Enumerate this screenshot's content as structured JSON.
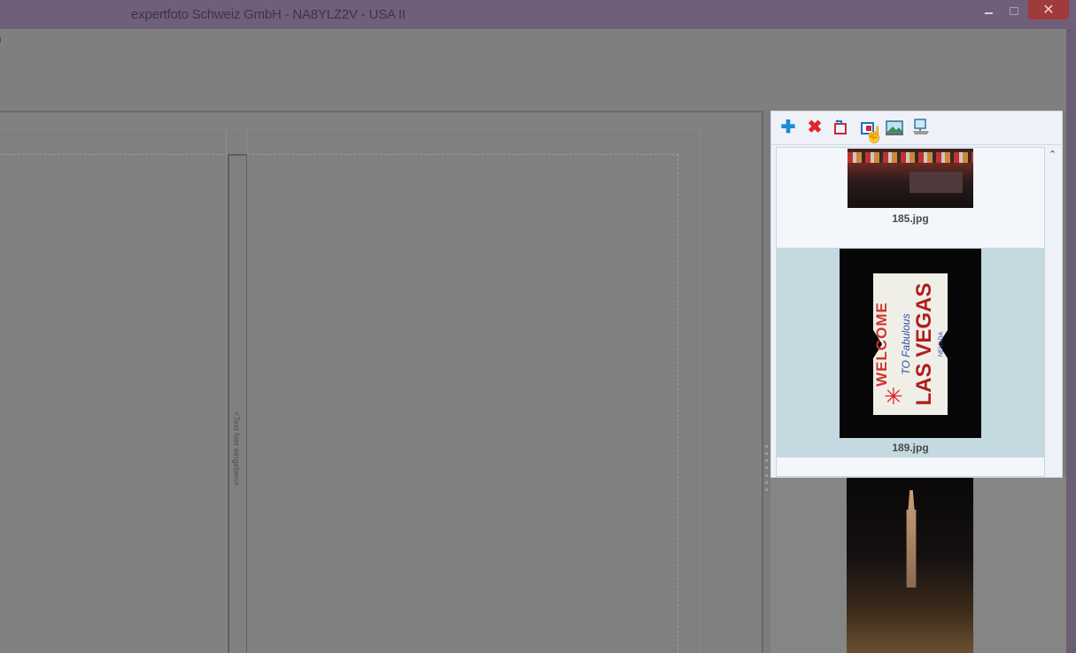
{
  "window": {
    "title": "expertfoto Schweiz GmbH - NA8YLZ2V - USA II",
    "minimize_icon": "minimize-icon",
    "maximize_icon": "maximize-icon",
    "close_label": "✕"
  },
  "canvas": {
    "spine_placeholder": "<Text hier eingeben>"
  },
  "image_panel": {
    "toolbar": [
      {
        "name": "add-image-button",
        "icon": "plus-icon",
        "glyph": "✚"
      },
      {
        "name": "delete-image-button",
        "icon": "x-icon",
        "glyph": "✖"
      },
      {
        "name": "rotate-left-button",
        "icon": "rotate-left-icon",
        "glyph": ""
      },
      {
        "name": "rotate-right-button",
        "icon": "rotate-right-icon",
        "glyph": ""
      },
      {
        "name": "image-edit-button",
        "icon": "picture-icon",
        "glyph": ""
      },
      {
        "name": "image-export-button",
        "icon": "monitor-icon",
        "glyph": ""
      }
    ],
    "thumbnails": [
      {
        "filename": "185.jpg",
        "selected": false
      },
      {
        "filename": "189.jpg",
        "selected": true
      }
    ],
    "scroll_up_glyph": "⌃"
  },
  "colors": {
    "titlebar": "#6f5f7b",
    "close_button": "#a03b3b",
    "selection": "#c5dae0",
    "add_icon": "#1c8ad6",
    "delete_icon": "#e0262c"
  }
}
